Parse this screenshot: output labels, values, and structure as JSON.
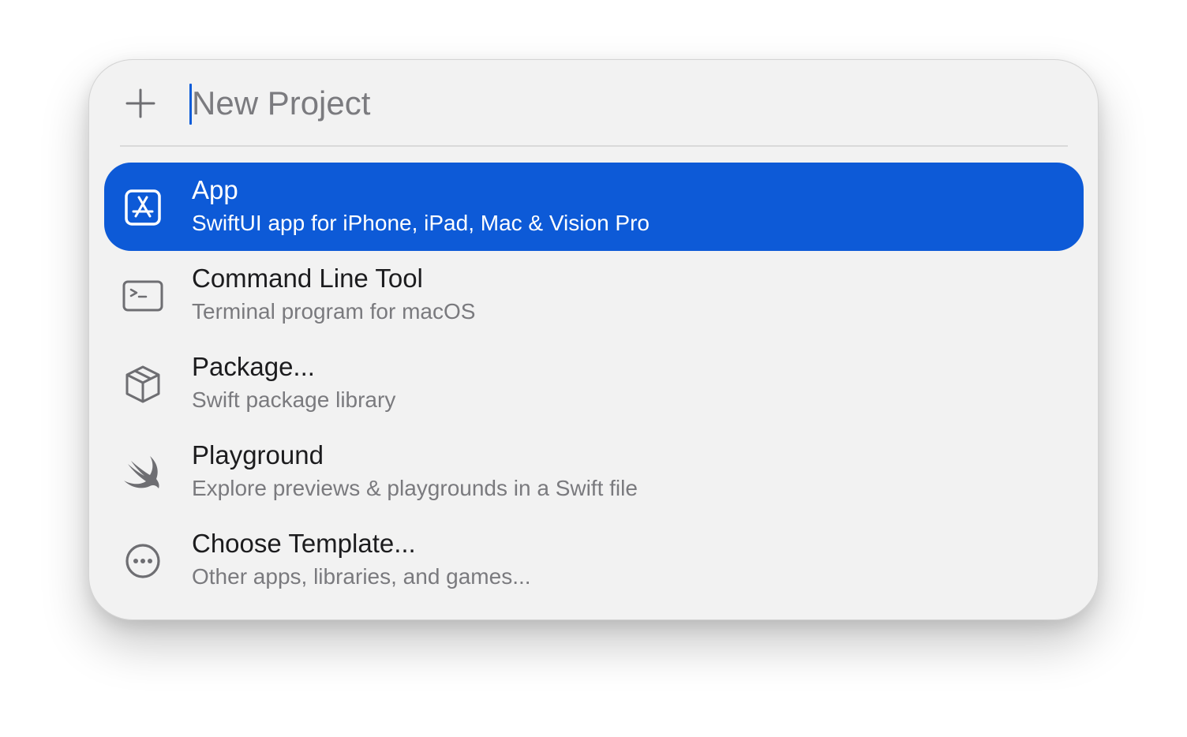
{
  "search": {
    "placeholder": "New Project",
    "value": ""
  },
  "icons": {
    "add": "plus-icon",
    "app": "app-store-icon",
    "command_line_tool": "terminal-icon",
    "package": "package-box-icon",
    "playground": "swift-icon",
    "choose_template": "ellipsis-circle-icon"
  },
  "colors": {
    "selection": "#0d5ad7",
    "panel_background": "#f2f2f2",
    "caret": "#0b5cd9",
    "title_text": "#1c1c1e",
    "subtitle_text": "#7a7a7e"
  },
  "items": [
    {
      "title": "App",
      "subtitle": "SwiftUI app for iPhone, iPad, Mac & Vision Pro",
      "selected": true
    },
    {
      "title": "Command Line Tool",
      "subtitle": "Terminal program for macOS",
      "selected": false
    },
    {
      "title": "Package...",
      "subtitle": "Swift package library",
      "selected": false
    },
    {
      "title": "Playground",
      "subtitle": "Explore previews & playgrounds in a Swift file",
      "selected": false
    },
    {
      "title": "Choose Template...",
      "subtitle": "Other apps, libraries, and games...",
      "selected": false
    }
  ]
}
